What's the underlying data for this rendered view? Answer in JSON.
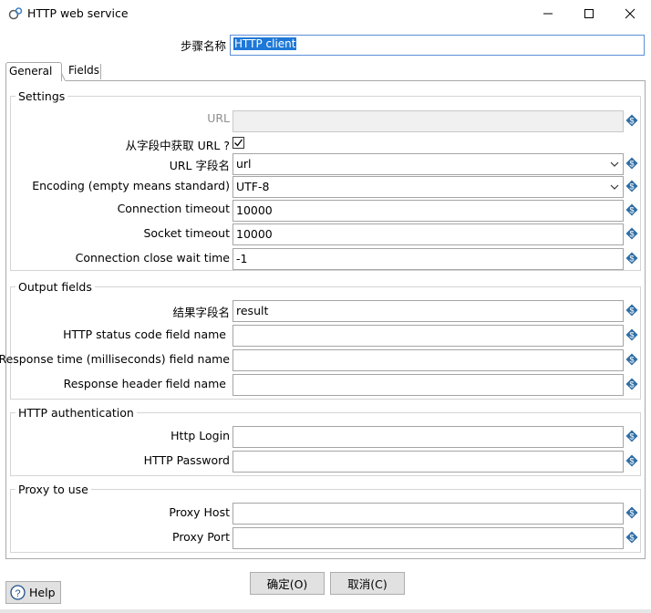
{
  "window": {
    "title": "HTTP web service",
    "minimize_icon": "minimize-icon",
    "maximize_icon": "maximize-icon",
    "close_icon": "close-icon"
  },
  "step": {
    "label": "步骤名称",
    "value": "HTTP client"
  },
  "tabs": [
    {
      "label": "General"
    },
    {
      "label": "Fields"
    }
  ],
  "settings": {
    "title": "Settings",
    "url_label": "URL",
    "url_value": "",
    "from_field_label": "从字段中获取 URL ?",
    "from_field_checked": true,
    "url_field_label": "URL 字段名",
    "url_field_value": "url",
    "encoding_label": "Encoding (empty means standard)",
    "encoding_value": "UTF-8",
    "conn_timeout_label": "Connection timeout",
    "conn_timeout_value": "10000",
    "socket_timeout_label": "Socket timeout",
    "socket_timeout_value": "10000",
    "close_wait_label": "Connection close wait time",
    "close_wait_value": "-1"
  },
  "output": {
    "title": "Output fields",
    "result_label": "结果字段名",
    "result_value": "result",
    "status_label": "HTTP status code field name",
    "status_value": "",
    "response_time_label": "Response time (milliseconds) field name",
    "response_time_value": "",
    "header_label": "Response header field name",
    "header_value": ""
  },
  "auth": {
    "title": "HTTP authentication",
    "login_label": "Http Login",
    "login_value": "",
    "password_label": "HTTP Password",
    "password_value": ""
  },
  "proxy": {
    "title": "Proxy to use",
    "host_label": "Proxy Host",
    "host_value": "",
    "port_label": "Proxy Port",
    "port_value": ""
  },
  "footer": {
    "help_label": "Help",
    "ok_label": "确定(O)",
    "cancel_label": "取消(C)"
  },
  "colors": {
    "selection": "#1e78d7",
    "variable_icon": "#2e6da4",
    "border": "#a9a9a9"
  }
}
